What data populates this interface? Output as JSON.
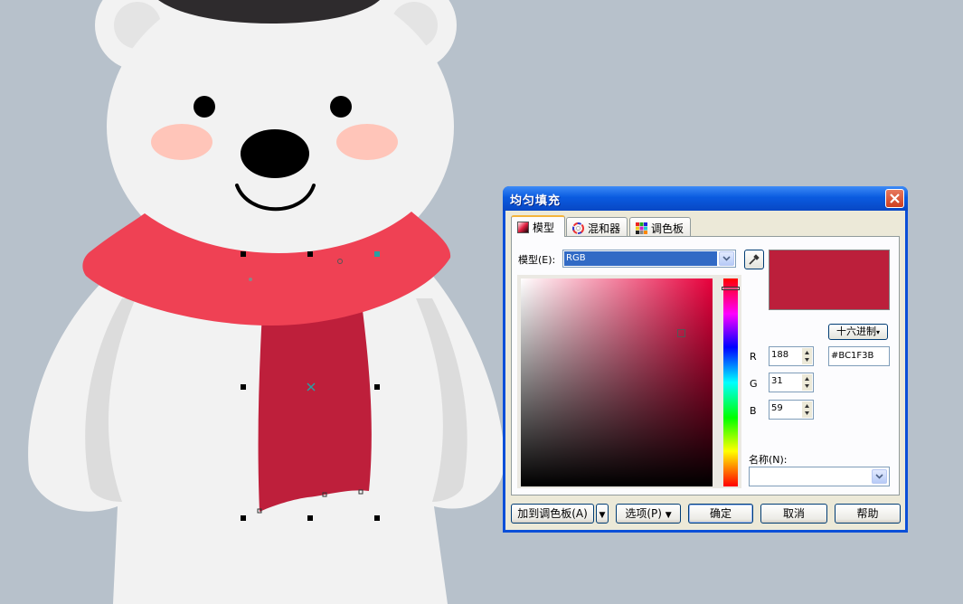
{
  "dialog": {
    "title": "均匀填充",
    "tabs": [
      {
        "label": "模型",
        "active": true
      },
      {
        "label": "混和器",
        "active": false
      },
      {
        "label": "调色板",
        "active": false
      }
    ],
    "model_label": "模型(E):",
    "model_value": "RGB",
    "hex_button_label": "十六进制",
    "channels": [
      {
        "label": "R",
        "value": "188"
      },
      {
        "label": "G",
        "value": "31"
      },
      {
        "label": "B",
        "value": "59"
      }
    ],
    "hex_value": "#BC1F3B",
    "name_label": "名称(N):",
    "name_value": "",
    "current_color": "#BC1F3B",
    "hue_position_fraction": 0.03,
    "buttons": {
      "add_to_palette": "加到调色板(A)",
      "options": "选项(P)",
      "ok": "确定",
      "cancel": "取消",
      "help": "帮助"
    }
  },
  "canvas": {
    "bear_fur_color": "#f2f2f2",
    "scarf_color": "#ef4154",
    "scarf_tail_color": "#be1f3b",
    "cheek_color": "#ffc5b9",
    "background_color": "#b7c1cb"
  }
}
